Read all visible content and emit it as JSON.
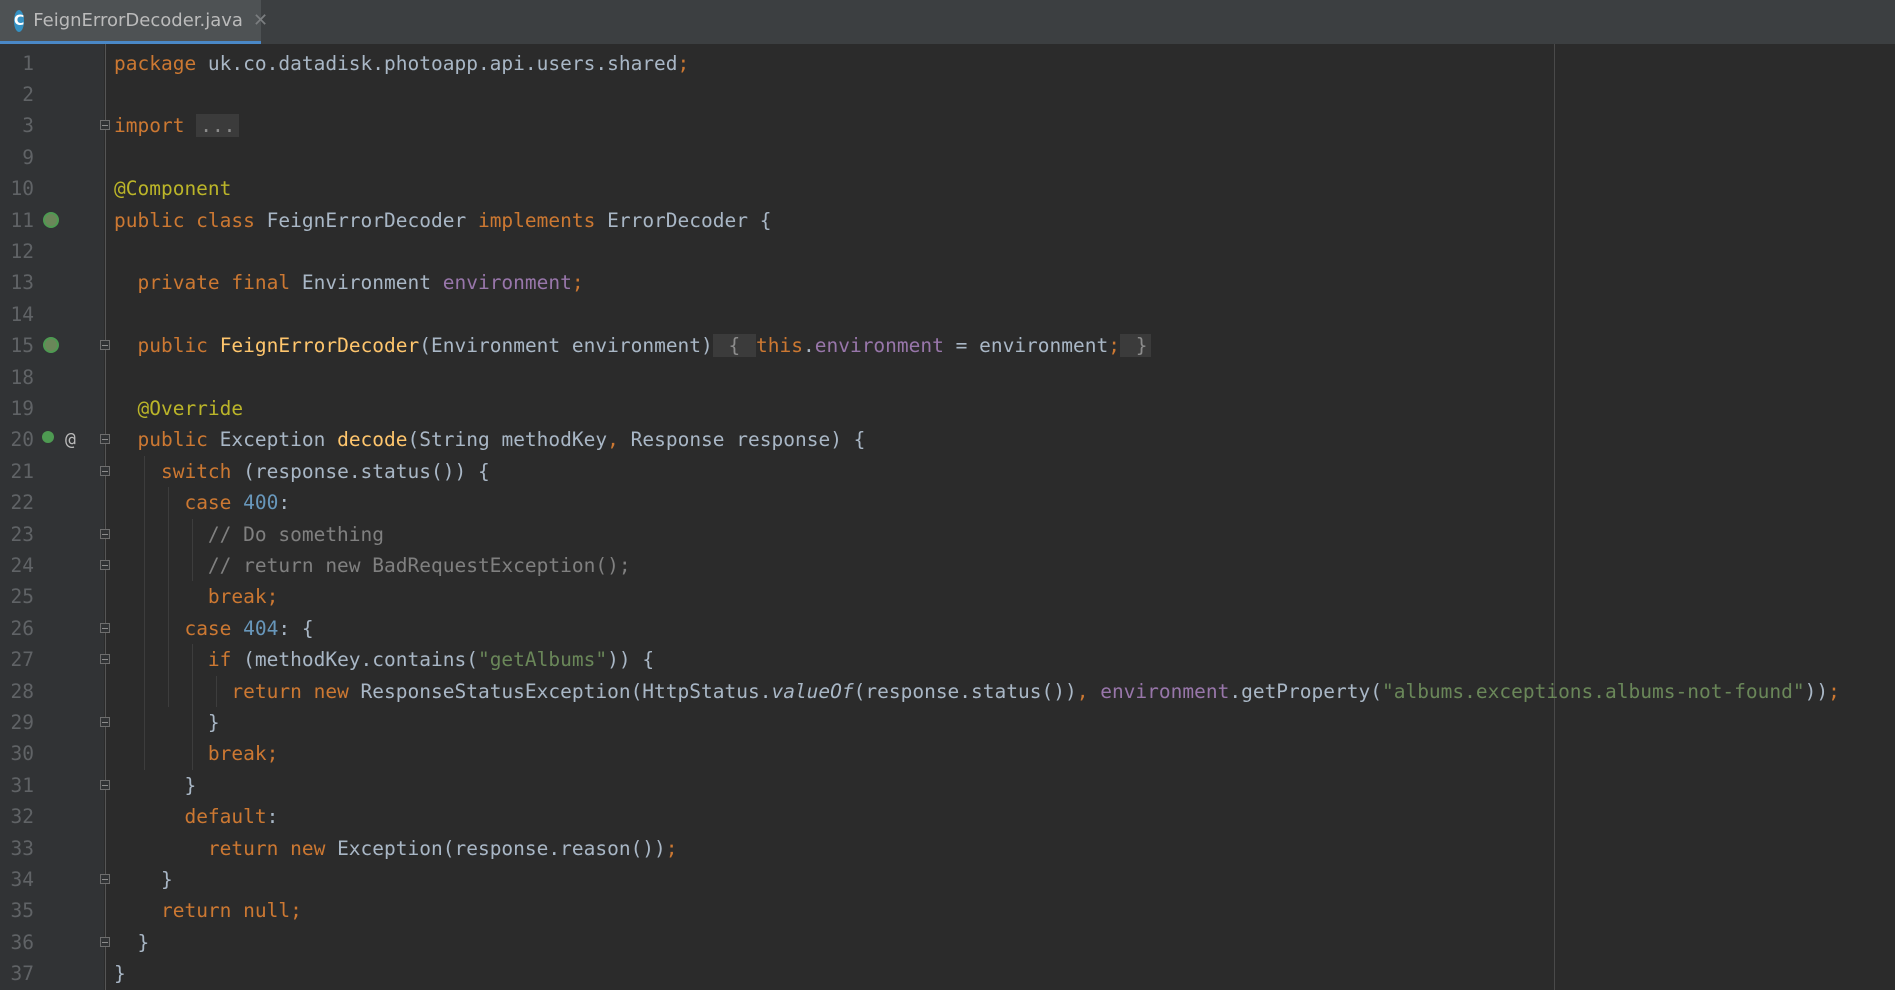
{
  "tab": {
    "icon": "C",
    "title": "FeignErrorDecoder.java",
    "close": "✕"
  },
  "gutter_icons": {
    "line11": "spring-bean-class-icon",
    "line15": "spring-bean-constructor-icon",
    "line20": "override-method-icon",
    "line20b": "at-annotation-icon"
  },
  "colors": {
    "keyword": "#cc7832",
    "annotation": "#bbb529",
    "field": "#9876aa",
    "number": "#6897bb",
    "string": "#6a8759",
    "comment": "#808080",
    "method": "#ffc66d",
    "text": "#a9b7c6",
    "background": "#2b2b2b"
  },
  "lines": [
    {
      "n": "1",
      "t": [
        [
          "package",
          "kw"
        ],
        [
          " uk.co.datadisk.photoapp.api.users.shared",
          ""
        ],
        [
          ";",
          "kw"
        ]
      ]
    },
    {
      "n": "2",
      "t": []
    },
    {
      "n": "3",
      "t": [
        [
          "import",
          "kw"
        ],
        [
          " ",
          ""
        ],
        [
          "...",
          "folded"
        ]
      ]
    },
    {
      "n": "9",
      "t": []
    },
    {
      "n": "10",
      "t": [
        [
          "@Component",
          "ann"
        ]
      ]
    },
    {
      "n": "11",
      "t": [
        [
          "public class",
          "kw"
        ],
        [
          " FeignErrorDecoder ",
          ""
        ],
        [
          "implements",
          "kw"
        ],
        [
          " ErrorDecoder {",
          ""
        ]
      ]
    },
    {
      "n": "12",
      "t": []
    },
    {
      "n": "13",
      "t": [
        [
          "  ",
          ""
        ],
        [
          "private final",
          "kw"
        ],
        [
          " Environment ",
          ""
        ],
        [
          "environment",
          "field"
        ],
        [
          ";",
          "kw"
        ]
      ]
    },
    {
      "n": "14",
      "t": []
    },
    {
      "n": "15",
      "t": [
        [
          "  ",
          ""
        ],
        [
          "public",
          "kw"
        ],
        [
          " ",
          ""
        ],
        [
          "FeignErrorDecoder",
          "fn"
        ],
        [
          "(Environment environment)",
          ""
        ],
        [
          " { ",
          "folded"
        ],
        [
          "this",
          "kw"
        ],
        [
          ".",
          ""
        ],
        [
          "environment",
          "field"
        ],
        [
          " = environment",
          ""
        ],
        [
          ";",
          "kw"
        ],
        [
          " }",
          "folded"
        ]
      ]
    },
    {
      "n": "18",
      "t": []
    },
    {
      "n": "19",
      "t": [
        [
          "  ",
          ""
        ],
        [
          "@Override",
          "ann"
        ]
      ]
    },
    {
      "n": "20",
      "t": [
        [
          "  ",
          ""
        ],
        [
          "public",
          "kw"
        ],
        [
          " Exception ",
          ""
        ],
        [
          "decode",
          "fn"
        ],
        [
          "(String methodKey",
          ""
        ],
        [
          ",",
          "kw"
        ],
        [
          " Response response) {",
          ""
        ]
      ]
    },
    {
      "n": "21",
      "t": [
        [
          "    ",
          ""
        ],
        [
          "switch",
          "kw"
        ],
        [
          " (response.status()) {",
          ""
        ]
      ]
    },
    {
      "n": "22",
      "t": [
        [
          "      ",
          ""
        ],
        [
          "case",
          "kw"
        ],
        [
          " ",
          ""
        ],
        [
          "400",
          "num"
        ],
        [
          ":",
          ""
        ]
      ]
    },
    {
      "n": "23",
      "t": [
        [
          "        ",
          ""
        ],
        [
          "// Do something",
          "com"
        ]
      ]
    },
    {
      "n": "24",
      "t": [
        [
          "        ",
          ""
        ],
        [
          "// return new BadRequestException();",
          "com"
        ]
      ]
    },
    {
      "n": "25",
      "t": [
        [
          "        ",
          ""
        ],
        [
          "break;",
          "kw"
        ]
      ]
    },
    {
      "n": "26",
      "t": [
        [
          "      ",
          ""
        ],
        [
          "case",
          "kw"
        ],
        [
          " ",
          ""
        ],
        [
          "404",
          "num"
        ],
        [
          ": {",
          ""
        ]
      ]
    },
    {
      "n": "27",
      "t": [
        [
          "        ",
          ""
        ],
        [
          "if",
          "kw"
        ],
        [
          " (methodKey.contains(",
          ""
        ],
        [
          "\"getAlbums\"",
          "str"
        ],
        [
          ")) {",
          ""
        ]
      ]
    },
    {
      "n": "28",
      "t": [
        [
          "          ",
          ""
        ],
        [
          "return new",
          "kw"
        ],
        [
          " ResponseStatusException(HttpStatus.",
          ""
        ],
        [
          "valueOf",
          "it"
        ],
        [
          "(response.status())",
          ""
        ],
        [
          ",",
          "kw"
        ],
        [
          " ",
          ""
        ],
        [
          "environment",
          "field"
        ],
        [
          ".getProperty(",
          ""
        ],
        [
          "\"albums.exceptions.albums-not-found\"",
          "str"
        ],
        [
          "))",
          ""
        ],
        [
          ";",
          "kw"
        ]
      ]
    },
    {
      "n": "29",
      "t": [
        [
          "        }",
          ""
        ]
      ]
    },
    {
      "n": "30",
      "t": [
        [
          "        ",
          ""
        ],
        [
          "break;",
          "kw"
        ]
      ]
    },
    {
      "n": "31",
      "t": [
        [
          "      }",
          ""
        ]
      ]
    },
    {
      "n": "32",
      "t": [
        [
          "      ",
          ""
        ],
        [
          "default",
          "kw"
        ],
        [
          ":",
          ""
        ]
      ]
    },
    {
      "n": "33",
      "t": [
        [
          "        ",
          ""
        ],
        [
          "return new",
          "kw"
        ],
        [
          " Exception(response.reason())",
          ""
        ],
        [
          ";",
          "kw"
        ]
      ]
    },
    {
      "n": "34",
      "t": [
        [
          "    }",
          ""
        ]
      ]
    },
    {
      "n": "35",
      "t": [
        [
          "    ",
          ""
        ],
        [
          "return null;",
          "kw"
        ]
      ]
    },
    {
      "n": "36",
      "t": [
        [
          "  }",
          ""
        ]
      ]
    },
    {
      "n": "37",
      "t": [
        [
          "}",
          ""
        ]
      ]
    }
  ]
}
